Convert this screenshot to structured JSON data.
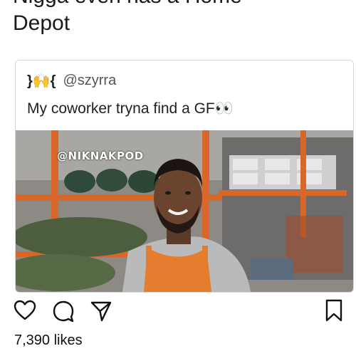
{
  "post": {
    "caption_line1": "Nigga even has a Home",
    "caption_line2": "Depot"
  },
  "tweet": {
    "handle": "@szyrra",
    "text": "My coworker tryna find a GF👀",
    "name_decor": "}🙌{"
  },
  "photo": {
    "watermark": "@NIKNAKPOD"
  },
  "actions": {
    "icons": [
      "heart-icon",
      "comment-icon",
      "share-icon",
      "bookmark-icon"
    ]
  },
  "likes_label": "7,390 likes",
  "colors": {
    "apron": "#e67c2e",
    "shelf": "#d9672a",
    "text": "#111111"
  }
}
